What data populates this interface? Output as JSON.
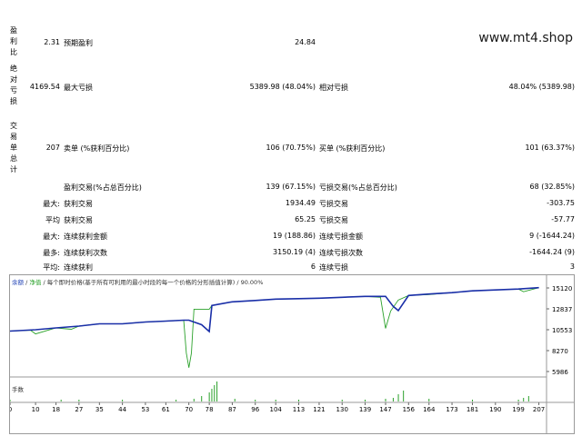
{
  "watermark": "www.mt4.shop",
  "sections": {
    "profit_factor_label": [
      "盈",
      "利",
      "比"
    ],
    "absolute_dd_label": [
      "绝",
      "对",
      "亏",
      "损"
    ],
    "trades_label": [
      "交",
      "易",
      "单",
      "总",
      "计"
    ]
  },
  "rows": {
    "r1": {
      "v1": "2.31",
      "l2": "预期盈利",
      "v2": "24.84"
    },
    "r2": {
      "v1": "4169.54",
      "l2": "最大亏损",
      "v2": "5389.98 (48.04%)",
      "l3": "相对亏损",
      "v3": "48.04% (5389.98)"
    },
    "r3": {
      "v1": "207",
      "l2": "卖单 (%获利百分比)",
      "v2": "106 (70.75%)",
      "l3": "买单 (%获利百分比)",
      "v3": "101 (63.37%)"
    },
    "r4": {
      "l2": "盈利交易(%占总百分比)",
      "v2": "139 (67.15%)",
      "l3": "亏损交易(%占总百分比)",
      "v3": "68 (32.85%)"
    },
    "r5": {
      "l1": "最大:",
      "l2": "获利交易",
      "v2": "1934.49",
      "l3": "亏损交易",
      "v3": "-303.75"
    },
    "r6": {
      "l1": "平均",
      "l2": "获利交易",
      "v2": "65.25",
      "l3": "亏损交易",
      "v3": "-57.77"
    },
    "r7": {
      "l1": "最大:",
      "l2": "连续获利金额",
      "v2": "19 (188.86)",
      "l3": "连续亏损金额",
      "v3": "9 (-1644.24)"
    },
    "r8": {
      "l1": "最多:",
      "l2": "连续获利次数",
      "v2": "3150.19 (4)",
      "l3": "连续亏损次数",
      "v3": "-1644.24 (9)"
    },
    "r9": {
      "l1": "平均:",
      "l2": "连续获利",
      "v2": "6",
      "l3": "连续亏损",
      "v3": "3"
    }
  },
  "chart": {
    "legend_balance": "余额",
    "legend_sep": "/",
    "legend_equity": "净值",
    "legend_rest": "/ 每个即时价格(基于所有可利用的最小时段的每一个价格的分形插值计算) / 90.00%",
    "volume_label": "手数",
    "colors": {
      "balance": "#1a2fa8",
      "equity": "#2aa12a",
      "volume": "#2aa12a"
    }
  },
  "chart_data": {
    "type": "line",
    "title": "",
    "y_ticks": [
      "15120",
      "12837",
      "10553",
      "8270",
      "5986"
    ],
    "x_ticks": [
      "0",
      "10",
      "18",
      "27",
      "35",
      "44",
      "53",
      "61",
      "70",
      "78",
      "87",
      "96",
      "104",
      "113",
      "121",
      "130",
      "139",
      "147",
      "156",
      "164",
      "173",
      "181",
      "190",
      "199",
      "207"
    ],
    "ylim": [
      5986,
      15120
    ],
    "series": [
      {
        "name": "余额",
        "x": [
          0,
          10,
          18,
          27,
          35,
          44,
          53,
          61,
          68,
          70,
          75,
          78,
          79,
          87,
          96,
          104,
          113,
          121,
          130,
          139,
          147,
          150,
          152,
          156,
          164,
          173,
          181,
          190,
          199,
          207
        ],
        "values": [
          10400,
          10550,
          10750,
          10950,
          11200,
          11200,
          11400,
          11500,
          11600,
          11600,
          11100,
          10350,
          13200,
          13600,
          13750,
          13900,
          13950,
          14000,
          14100,
          14200,
          14200,
          13100,
          12650,
          14300,
          14450,
          14600,
          14800,
          14900,
          15000,
          15150
        ]
      },
      {
        "name": "净值",
        "x": [
          0,
          8,
          10,
          18,
          24,
          27,
          35,
          44,
          53,
          61,
          68,
          69,
          70,
          71,
          72,
          78,
          79,
          87,
          96,
          104,
          113,
          121,
          130,
          139,
          145,
          147,
          149,
          152,
          156,
          164,
          173,
          181,
          190,
          199,
          201,
          207
        ],
        "values": [
          10400,
          10500,
          10100,
          10750,
          10600,
          10950,
          11200,
          11200,
          11400,
          11500,
          11600,
          8000,
          6400,
          8000,
          12800,
          12800,
          13200,
          13600,
          13750,
          13900,
          13950,
          14000,
          14100,
          14200,
          14100,
          10700,
          12600,
          13800,
          14300,
          14400,
          14600,
          14800,
          14900,
          15000,
          14700,
          15150
        ]
      }
    ]
  }
}
